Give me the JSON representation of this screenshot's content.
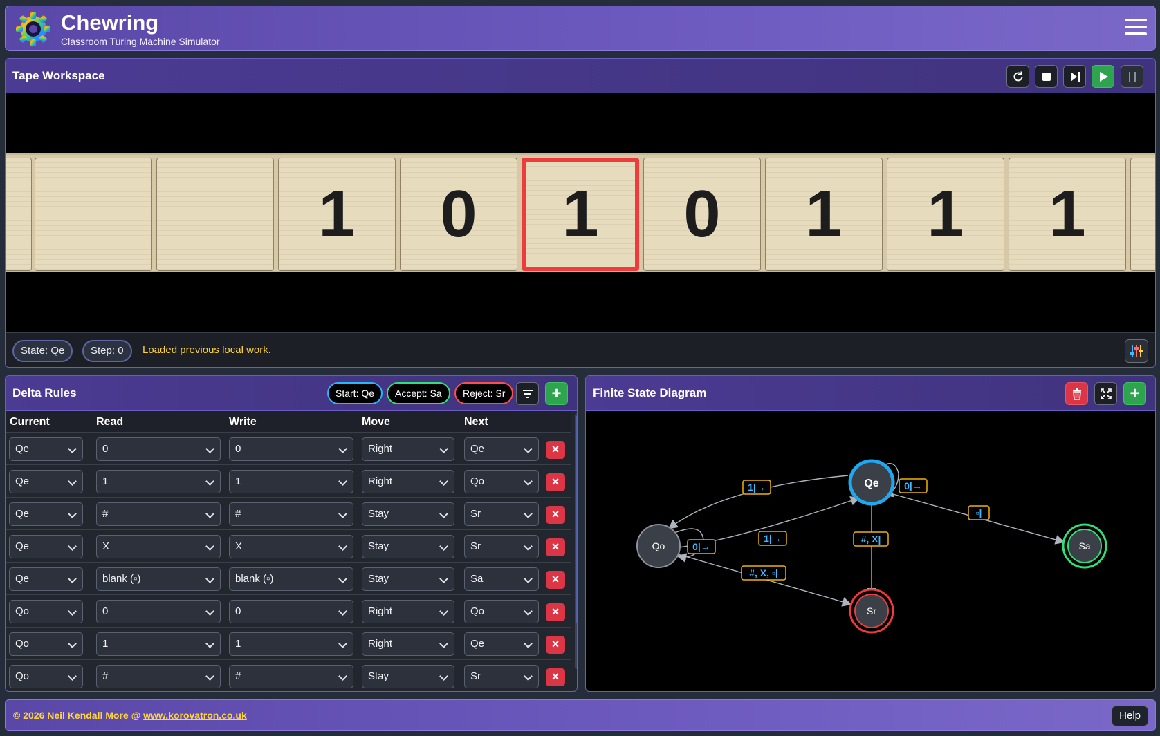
{
  "app": {
    "title": "Chewring",
    "subtitle": "Classroom Turing Machine Simulator"
  },
  "tape": {
    "title": "Tape Workspace",
    "cells": [
      "",
      "",
      "",
      "1",
      "0",
      "1",
      "0",
      "1",
      "1",
      "1",
      ""
    ],
    "head_index": 5
  },
  "status": {
    "state": "State: Qe",
    "step": "Step: 0",
    "message": "Loaded previous local work."
  },
  "delta": {
    "title": "Delta Rules",
    "start": "Start: Qe",
    "accept": "Accept: Sa",
    "reject": "Reject: Sr",
    "columns": [
      "Current",
      "Read",
      "Write",
      "Move",
      "Next"
    ],
    "rows": [
      {
        "current": "Qe",
        "read": "0",
        "write": "0",
        "move": "Right",
        "next": "Qe"
      },
      {
        "current": "Qe",
        "read": "1",
        "write": "1",
        "move": "Right",
        "next": "Qo"
      },
      {
        "current": "Qe",
        "read": "#",
        "write": "#",
        "move": "Stay",
        "next": "Sr"
      },
      {
        "current": "Qe",
        "read": "X",
        "write": "X",
        "move": "Stay",
        "next": "Sr"
      },
      {
        "current": "Qe",
        "read": "blank (▫)",
        "write": "blank (▫)",
        "move": "Stay",
        "next": "Sa"
      },
      {
        "current": "Qo",
        "read": "0",
        "write": "0",
        "move": "Right",
        "next": "Qo"
      },
      {
        "current": "Qo",
        "read": "1",
        "write": "1",
        "move": "Right",
        "next": "Qe"
      },
      {
        "current": "Qo",
        "read": "#",
        "write": "#",
        "move": "Stay",
        "next": "Sr"
      }
    ],
    "delete_glyph": "×",
    "add_glyph": "+"
  },
  "fsd": {
    "title": "Finite State Diagram",
    "states": [
      {
        "name": "Qe",
        "kind": "start"
      },
      {
        "name": "Qo",
        "kind": "normal"
      },
      {
        "name": "Sa",
        "kind": "accept"
      },
      {
        "name": "Sr",
        "kind": "reject"
      }
    ],
    "edge_labels": {
      "qo_to_qe_top": "1|→",
      "qe_self": "0|→",
      "qe_to_sa": "▫|",
      "qo_self": "0|→",
      "qo_to_qe": "1|→",
      "qe_to_sr": "#, X|",
      "qo_to_sr": "#, X, ▫|"
    },
    "colors": {
      "start": "#1da8f2",
      "accept": "#2fe077",
      "reject": "#ef3b3b",
      "label_border": "#f0b400",
      "label_text": "#3fb8ff",
      "arrow_text": "#2fe077"
    }
  },
  "footer": {
    "copyright": "© 2026 Neil Kendall More @ ",
    "link": "www.korovatron.co.uk",
    "help": "Help"
  },
  "icons": [
    "gear-logo-icon",
    "hamburger-menu-icon",
    "reset-icon",
    "stop-icon",
    "step-icon",
    "play-icon",
    "pause-icon",
    "sliders-icon",
    "filter-icon",
    "plus-icon",
    "trash-icon",
    "fullscreen-icon"
  ]
}
